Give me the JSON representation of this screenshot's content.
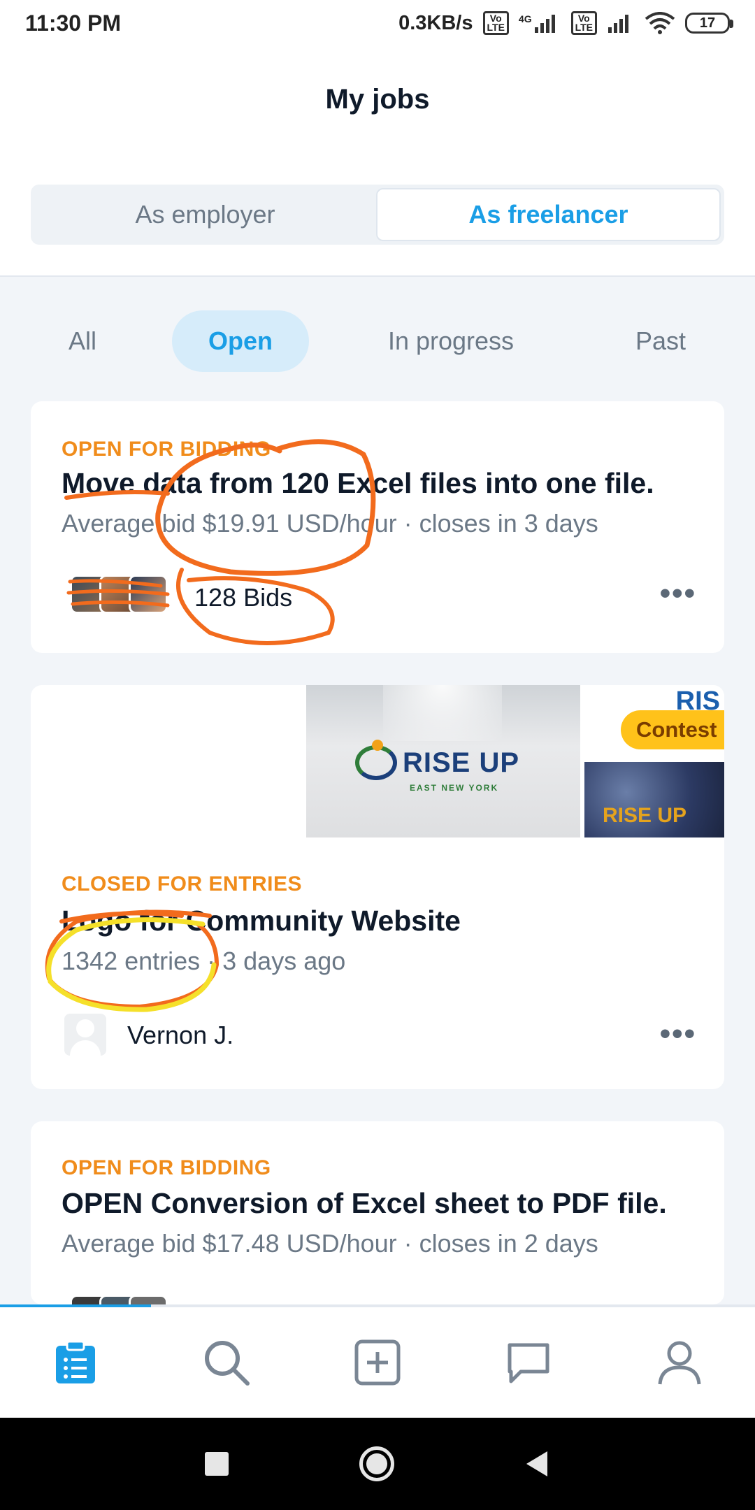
{
  "status_bar": {
    "time": "11:30 PM",
    "net_speed": "0.3KB/s",
    "lte_badge": "Vo LTE",
    "network": "4G",
    "battery": "17"
  },
  "header": {
    "title": "My jobs",
    "segments": [
      "As employer",
      "As freelancer"
    ],
    "active_segment": "As freelancer"
  },
  "filters": {
    "items": [
      "All",
      "Open",
      "In progress",
      "Past"
    ],
    "active": "Open"
  },
  "jobs": [
    {
      "status": "OPEN FOR BIDDING",
      "title": "Move data from 120 Excel files into one file.",
      "meta": "Average bid $19.91 USD/hour · closes in 3 days",
      "bids": "128 Bids"
    },
    {
      "status": "CLOSED FOR ENTRIES",
      "title": "Logo for Community Website",
      "meta": "1342 entries · 3 days ago",
      "badge": "Contest",
      "user": "Vernon J.",
      "logo_text": "RISE UP",
      "logo_subtext": "EAST NEW YORK",
      "side_text_top": "RIS",
      "side_text_bottom": "RISE UP"
    },
    {
      "status": "OPEN FOR BIDDING",
      "title": "OPEN Conversion of Excel sheet to PDF file.",
      "meta": "Average bid $17.48 USD/hour · closes in 2 days"
    }
  ],
  "bottom_nav": {
    "items": [
      "clipboard-icon",
      "search-icon",
      "add-icon",
      "chat-icon",
      "profile-icon"
    ],
    "active": "clipboard-icon"
  },
  "colors": {
    "accent": "#1a9ee6",
    "status_orange": "#f08c1b",
    "contest_yellow": "#ffc21a",
    "annotation_orange": "#f26b1d",
    "annotation_yellow": "#f5e02a"
  }
}
